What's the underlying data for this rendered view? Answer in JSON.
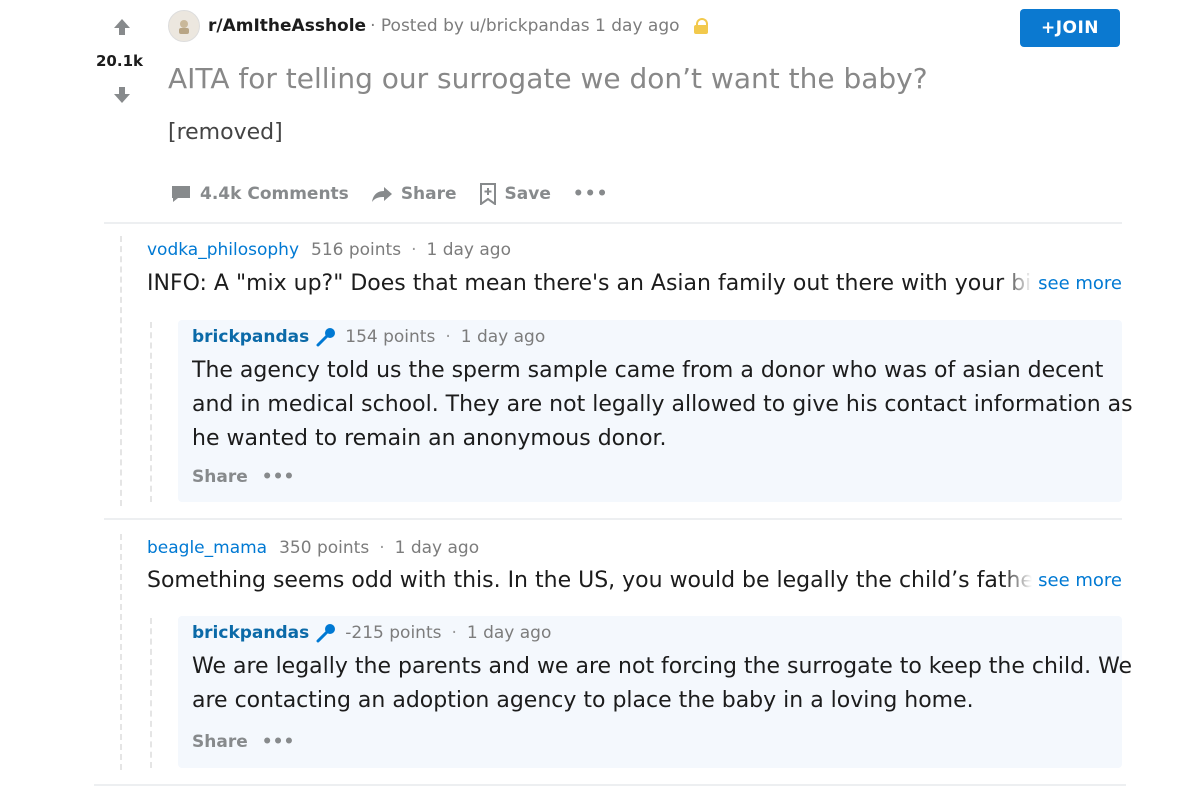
{
  "post": {
    "score": "20.1k",
    "subreddit": "r/AmItheAsshole",
    "posted_by": "· Posted by u/brickpandas 1 day ago",
    "join_label": "+JOIN",
    "title": "AITA for telling our surrogate we don’t want the baby?",
    "body": "[removed]",
    "actions": {
      "comments": "4.4k Comments",
      "share": "Share",
      "save": "Save",
      "more": "•••"
    }
  },
  "comments": [
    {
      "user": "vodka_philosophy",
      "points": "516 points",
      "time": "1 day ago",
      "text": "INFO: A \"mix up?\" Does that mean there's an Asian family out there with your biolo",
      "see_more": "see more",
      "reply": {
        "user": "brickpandas",
        "points": "154 points",
        "time": "1 day ago",
        "lines": [
          "The agency told us the sperm sample came from a donor who was of asian decent",
          "and in medical school. They are not legally allowed to give his contact information as",
          "he wanted to remain an anonymous donor."
        ],
        "share": "Share",
        "more": "•••"
      }
    },
    {
      "user": "beagle_mama",
      "points": "350 points",
      "time": "1 day ago",
      "text": "Something seems odd with this. In the US, you would be legally the child’s father a",
      "see_more": "see more",
      "reply": {
        "user": "brickpandas",
        "points": "-215 points",
        "time": "1 day ago",
        "lines": [
          "We are legally the parents and we are not forcing the surrogate to keep the child. We",
          "are contacting an adoption agency to place the baby in a loving home."
        ],
        "share": "Share",
        "more": "•••"
      }
    }
  ],
  "colors": {
    "accent": "#0079d3",
    "join_bg": "#0b79d0",
    "reply_bg": "#f4f8fd",
    "lock": "#f2c94c"
  },
  "icons": [
    "upvote-icon",
    "downvote-icon",
    "subreddit-avatar-icon",
    "lock-icon",
    "comment-icon",
    "share-icon",
    "save-icon",
    "mic-icon"
  ]
}
